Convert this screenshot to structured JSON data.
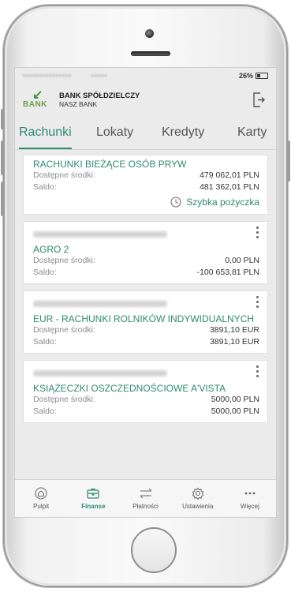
{
  "colors": {
    "accent": "#2f8a72",
    "brand_green": "#3c9a3c"
  },
  "status": {
    "battery": "26%"
  },
  "header": {
    "logo_text": "BANK",
    "bank_line1": "BANK SPÓŁDZIELCZY",
    "bank_line2": "NASZ BANK",
    "logout_icon": "logout-icon"
  },
  "tabs": [
    {
      "label": "Rachunki",
      "active": true
    },
    {
      "label": "Lokaty",
      "active": false
    },
    {
      "label": "Kredyty",
      "active": false
    },
    {
      "label": "Karty",
      "active": false
    }
  ],
  "accounts": [
    {
      "name": "RACHUNKI BIEŻĄCE OSÓB PRYW",
      "available_label": "Dostępne środki:",
      "available": "479 062,01 PLN",
      "balance_label": "Saldo:",
      "balance": "481 362,01 PLN",
      "action_label": "Szybka pożyczka"
    },
    {
      "name": "AGRO 2",
      "available_label": "Dostępne środki:",
      "available": "0,00 PLN",
      "balance_label": "Saldo:",
      "balance": "-100 653,81 PLN"
    },
    {
      "name": "EUR - RACHUNKI ROLNIKÓW INDYWIDUALNYCH",
      "available_label": "Dostępne środki:",
      "available": "3891,10 EUR",
      "balance_label": "Saldo:",
      "balance": "3891,10 EUR"
    },
    {
      "name": "KSIĄŻECZKI OSZCZEDNOŚCIOWE A'VISTA",
      "available_label": "Dostępne środki:",
      "available": "5000,00 PLN",
      "balance_label": "Saldo:",
      "balance": "5000,00 PLN"
    }
  ],
  "bottom_nav": [
    {
      "label": "Pulpit",
      "icon": "home-icon",
      "active": false
    },
    {
      "label": "Finanse",
      "icon": "wallet-icon",
      "active": true
    },
    {
      "label": "Płatności",
      "icon": "transfer-arrows-icon",
      "active": false
    },
    {
      "label": "Ustawienia",
      "icon": "gear-icon",
      "active": false
    },
    {
      "label": "Więcej",
      "icon": "more-dots-icon",
      "active": false
    }
  ]
}
